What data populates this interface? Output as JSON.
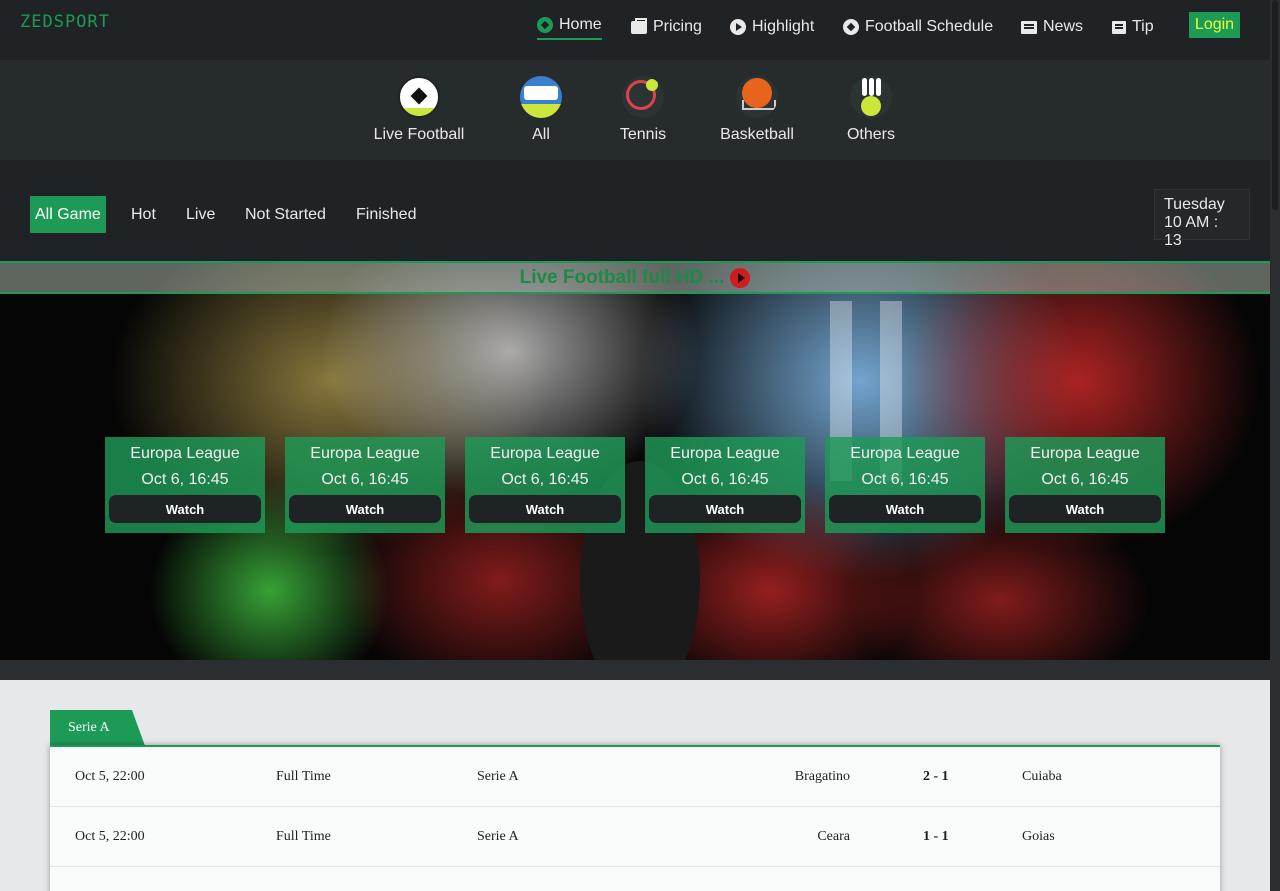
{
  "logo": "ZEDSPORT",
  "nav": {
    "items": [
      {
        "label": "Home",
        "icon": "football-icon"
      },
      {
        "label": "Pricing",
        "icon": "briefcase-icon"
      },
      {
        "label": "Highlight",
        "icon": "play-circle-icon"
      },
      {
        "label": "Football Schedule",
        "icon": "football-icon"
      },
      {
        "label": "News",
        "icon": "newspaper-icon"
      },
      {
        "label": "Tip",
        "icon": "list-icon"
      }
    ],
    "login": "Login"
  },
  "categories": [
    {
      "label": "Live Football",
      "icon": "soccer-ball-icon"
    },
    {
      "label": "All",
      "icon": "stadium-icon"
    },
    {
      "label": "Tennis",
      "icon": "tennis-racket-icon"
    },
    {
      "label": "Basketball",
      "icon": "basketball-icon"
    },
    {
      "label": "Others",
      "icon": "bowling-icon"
    }
  ],
  "filters": [
    "All Game",
    "Hot",
    "Live",
    "Not Started",
    "Finished"
  ],
  "clock": {
    "day": "Tuesday",
    "time": "10 AM : 13"
  },
  "hero": {
    "title": "Live Football full HD ...",
    "cards": [
      {
        "league": "Europa League",
        "when": "Oct 6, 16:45",
        "watch": "Watch"
      },
      {
        "league": "Europa League",
        "when": "Oct 6, 16:45",
        "watch": "Watch"
      },
      {
        "league": "Europa League",
        "when": "Oct 6, 16:45",
        "watch": "Watch"
      },
      {
        "league": "Europa League",
        "when": "Oct 6, 16:45",
        "watch": "Watch"
      },
      {
        "league": "Europa League",
        "when": "Oct 6, 16:45",
        "watch": "Watch"
      },
      {
        "league": "Europa League",
        "when": "Oct 6, 16:45",
        "watch": "Watch"
      }
    ]
  },
  "league_tab": "Serie A",
  "matches": [
    {
      "date": "Oct 5, 22:00",
      "status": "Full Time",
      "league": "Serie A",
      "home": "Bragatino",
      "score": "2 - 1",
      "away": "Cuiaba"
    },
    {
      "date": "Oct 5, 22:00",
      "status": "Full Time",
      "league": "Serie A",
      "home": "Ceara",
      "score": "1 - 1",
      "away": "Goias"
    }
  ],
  "colors": {
    "accent": "#1e9a57",
    "login_text": "#e6ff3a",
    "dark": "#1f2326"
  }
}
